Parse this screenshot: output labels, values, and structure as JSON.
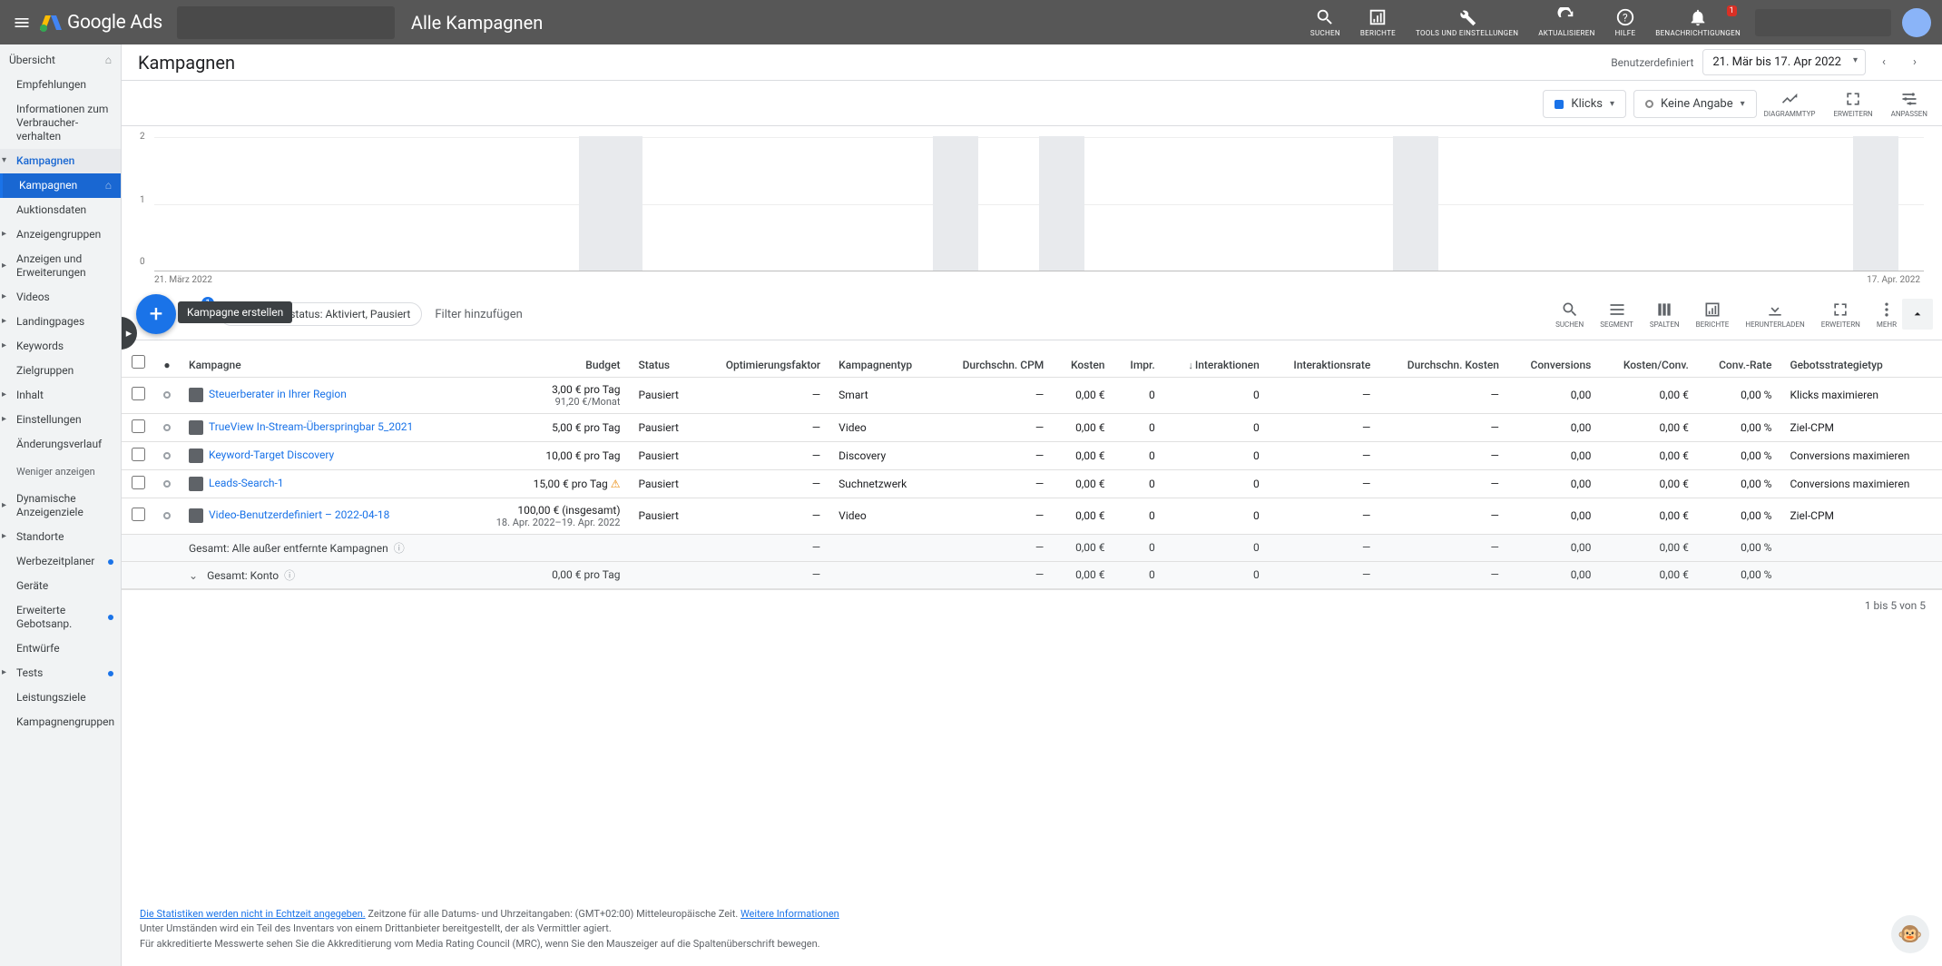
{
  "header": {
    "logo_text": "Google Ads",
    "scope_title": "Alle Kampagnen",
    "icons": {
      "search": "SUCHEN",
      "reports": "BERICHTE",
      "tools": "TOOLS UND EINSTELLUNGEN",
      "refresh": "AKTUALISIEREN",
      "help": "HILFE",
      "notifications": "BENACHRICHTIGUNGEN",
      "notif_count": "1"
    }
  },
  "subheader": {
    "page_title": "Kampagnen",
    "date_mode": "Benutzerdefiniert",
    "date_range": "21. Mär bis 17. Apr 2022"
  },
  "sidebar": {
    "overview": "Übersicht",
    "recommendations": "Empfehlungen",
    "consumer_info": "Informationen zum Verbraucher-verhalten",
    "campaigns": "Kampagnen",
    "campaigns_sub": "Kampagnen",
    "auction": "Auktionsdaten",
    "adgroups": "Anzeigengruppen",
    "ads_ext": "Anzeigen und Erweiterungen",
    "videos": "Videos",
    "landing": "Landingpages",
    "keywords": "Keywords",
    "audiences": "Zielgruppen",
    "content": "Inhalt",
    "settings": "Einstellungen",
    "changes": "Änderungsverlauf",
    "show_less": "Weniger anzeigen",
    "dynamic": "Dynamische Anzeigenziele",
    "locations": "Standorte",
    "adschedule": "Werbezeitplaner",
    "devices": "Geräte",
    "bid_adj": "Erweiterte Gebotsanp.",
    "drafts": "Entwürfe",
    "tests": "Tests",
    "perf_targets": "Leistungsziele",
    "camp_groups": "Kampagnengruppen"
  },
  "selectors": {
    "metric1": "Klicks",
    "metric2": "Keine Angabe",
    "chart_type": "DIAGRAMMTYP",
    "expand": "ERWEITERN",
    "adjust": "ANPASSEN"
  },
  "chart_data": {
    "type": "bar",
    "categories": [
      "21. März 2022",
      "17. Apr. 2022"
    ],
    "series": [
      {
        "name": "Klicks",
        "values": [
          0,
          0,
          0,
          0,
          0,
          0,
          0,
          0,
          0,
          0,
          0,
          0,
          0,
          0,
          0,
          0,
          0,
          0,
          0,
          0,
          0,
          0,
          0,
          0,
          0,
          0,
          0,
          0
        ]
      }
    ],
    "ylim": [
      0,
      2
    ],
    "yticks": [
      0,
      1,
      2
    ],
    "x_start": "21. März 2022",
    "x_end": "17. Apr. 2022"
  },
  "toolbar": {
    "fab_tooltip": "Kampagne erstellen",
    "funnel_badge": "1",
    "status_chip": "Kampagnenstatus: Aktiviert, Pausiert",
    "add_filter": "Filter hinzufügen",
    "icons": {
      "search": "SUCHEN",
      "segment": "SEGMENT",
      "columns": "SPALTEN",
      "reports": "BERICHTE",
      "download": "HERUNTERLADEN",
      "expand": "ERWEITERN",
      "more": "MEHR"
    }
  },
  "table": {
    "headers": {
      "campaign": "Kampagne",
      "budget": "Budget",
      "status": "Status",
      "opt": "Optimierungsfaktor",
      "type": "Kampagnentyp",
      "cpm": "Durchschn. CPM",
      "cost": "Kosten",
      "impr": "Impr.",
      "inter": "Interaktionen",
      "inter_rate": "Interaktionsrate",
      "cost_avg": "Durchschn. Kosten",
      "conv": "Conversions",
      "cost_conv": "Kosten/Conv.",
      "conv_rate": "Conv.-Rate",
      "bid_strat": "Gebotsstrategietyp"
    },
    "rows": [
      {
        "name": "Steuerberater in Ihrer Region",
        "budget": "3,00 € pro Tag",
        "budget2": "91,20 €/Monat",
        "status": "Pausiert",
        "opt": "—",
        "type": "Smart",
        "cpm": "—",
        "cost": "0,00 €",
        "impr": "0",
        "inter": "0",
        "inter_rate": "—",
        "cost_avg": "—",
        "conv": "0,00",
        "cost_conv": "0,00 €",
        "conv_rate": "0,00 %",
        "bid": "Klicks maximieren"
      },
      {
        "name": "TrueView In-Stream-Überspringbar 5_2021",
        "budget": "5,00 € pro Tag",
        "budget2": "",
        "status": "Pausiert",
        "opt": "—",
        "type": "Video",
        "cpm": "—",
        "cost": "0,00 €",
        "impr": "0",
        "inter": "0",
        "inter_rate": "—",
        "cost_avg": "—",
        "conv": "0,00",
        "cost_conv": "0,00 €",
        "conv_rate": "0,00 %",
        "bid": "Ziel-CPM"
      },
      {
        "name": "Keyword-Target Discovery",
        "budget": "10,00 € pro Tag",
        "budget2": "",
        "status": "Pausiert",
        "opt": "—",
        "type": "Discovery",
        "cpm": "—",
        "cost": "0,00 €",
        "impr": "0",
        "inter": "0",
        "inter_rate": "—",
        "cost_avg": "—",
        "conv": "0,00",
        "cost_conv": "0,00 €",
        "conv_rate": "0,00 %",
        "bid": "Conversions maximieren"
      },
      {
        "name": "Leads-Search-1",
        "budget": "15,00 € pro Tag",
        "budget2": "",
        "warn": true,
        "status": "Pausiert",
        "opt": "—",
        "type": "Suchnetzwerk",
        "cpm": "—",
        "cost": "0,00 €",
        "impr": "0",
        "inter": "0",
        "inter_rate": "—",
        "cost_avg": "—",
        "conv": "0,00",
        "cost_conv": "0,00 €",
        "conv_rate": "0,00 %",
        "bid": "Conversions maximieren"
      },
      {
        "name": "Video-Benutzerdefiniert – 2022-04-18",
        "budget": "100,00 € (insgesamt)",
        "budget2": "18. Apr. 2022–19. Apr. 2022",
        "status": "Pausiert",
        "opt": "—",
        "type": "Video",
        "cpm": "—",
        "cost": "0,00 €",
        "impr": "0",
        "inter": "0",
        "inter_rate": "—",
        "cost_avg": "—",
        "conv": "0,00",
        "cost_conv": "0,00 €",
        "conv_rate": "0,00 %",
        "bid": "Ziel-CPM"
      }
    ],
    "totals": [
      {
        "label": "Gesamt: Alle außer entfernte Kampagnen",
        "budget": "",
        "opt": "—",
        "cpm": "—",
        "cost": "0,00 €",
        "impr": "0",
        "inter": "0",
        "inter_rate": "—",
        "cost_avg": "—",
        "conv": "0,00",
        "cost_conv": "0,00 €",
        "conv_rate": "0,00 %"
      },
      {
        "label": "Gesamt: Konto",
        "budget": "0,00 € pro Tag",
        "opt": "—",
        "cpm": "—",
        "cost": "0,00 €",
        "impr": "0",
        "inter": "0",
        "inter_rate": "—",
        "cost_avg": "—",
        "conv": "0,00",
        "cost_conv": "0,00 €",
        "conv_rate": "0,00 %"
      }
    ],
    "pager": "1 bis 5 von 5"
  },
  "footer": {
    "line1_link": "Die Statistiken werden nicht in Echtzeit angegeben.",
    "line1_rest": " Zeitzone für alle Datums- und Uhrzeitangaben: (GMT+02:00) Mitteleuropäische Zeit. ",
    "line1_more": "Weitere Informationen",
    "line2": "Unter Umständen wird ein Teil des Inventars von einem Drittanbieter bereitgestellt, der als Vermittler agiert.",
    "line3": "Für akkreditierte Messwerte sehen Sie die Akkreditierung vom Media Rating Council (MRC), wenn Sie den Mauszeiger auf die Spaltenüberschrift bewegen."
  }
}
